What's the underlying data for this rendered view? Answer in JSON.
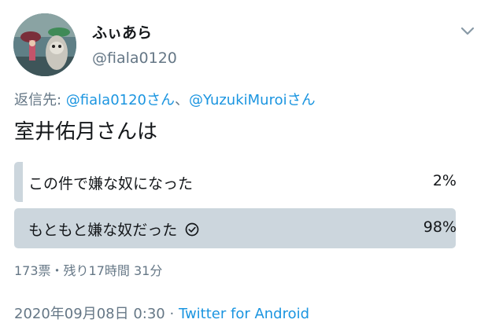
{
  "user": {
    "display_name": "ふぃあら",
    "handle": "@fiala0120"
  },
  "icons": {
    "more": "chevron-down-icon",
    "voted": "check-circle-icon",
    "avatar": "avatar-image"
  },
  "reply": {
    "prefix": "返信先: ",
    "mention_1": "@fiala0120さん",
    "separator": "、",
    "mention_2": "@YuzukiMuroiさん"
  },
  "tweet_text": "室井佑月さんは",
  "poll": {
    "options": [
      {
        "label": "この件で嫌な奴になった",
        "percent_text": "2%",
        "percent": 2,
        "voted": false
      },
      {
        "label": "もともと嫌な奴だった",
        "percent_text": "98%",
        "percent": 98,
        "voted": true
      }
    ],
    "meta": "173票・残り17時間 31分"
  },
  "timestamp": {
    "date_time": "2020年09月08日 0:30",
    "separator": " · ",
    "source": "Twitter for Android"
  },
  "colors": {
    "bar": "#ccd6dd",
    "link": "#1b95e0",
    "secondary_text": "#657786",
    "primary_text": "#14171a"
  }
}
